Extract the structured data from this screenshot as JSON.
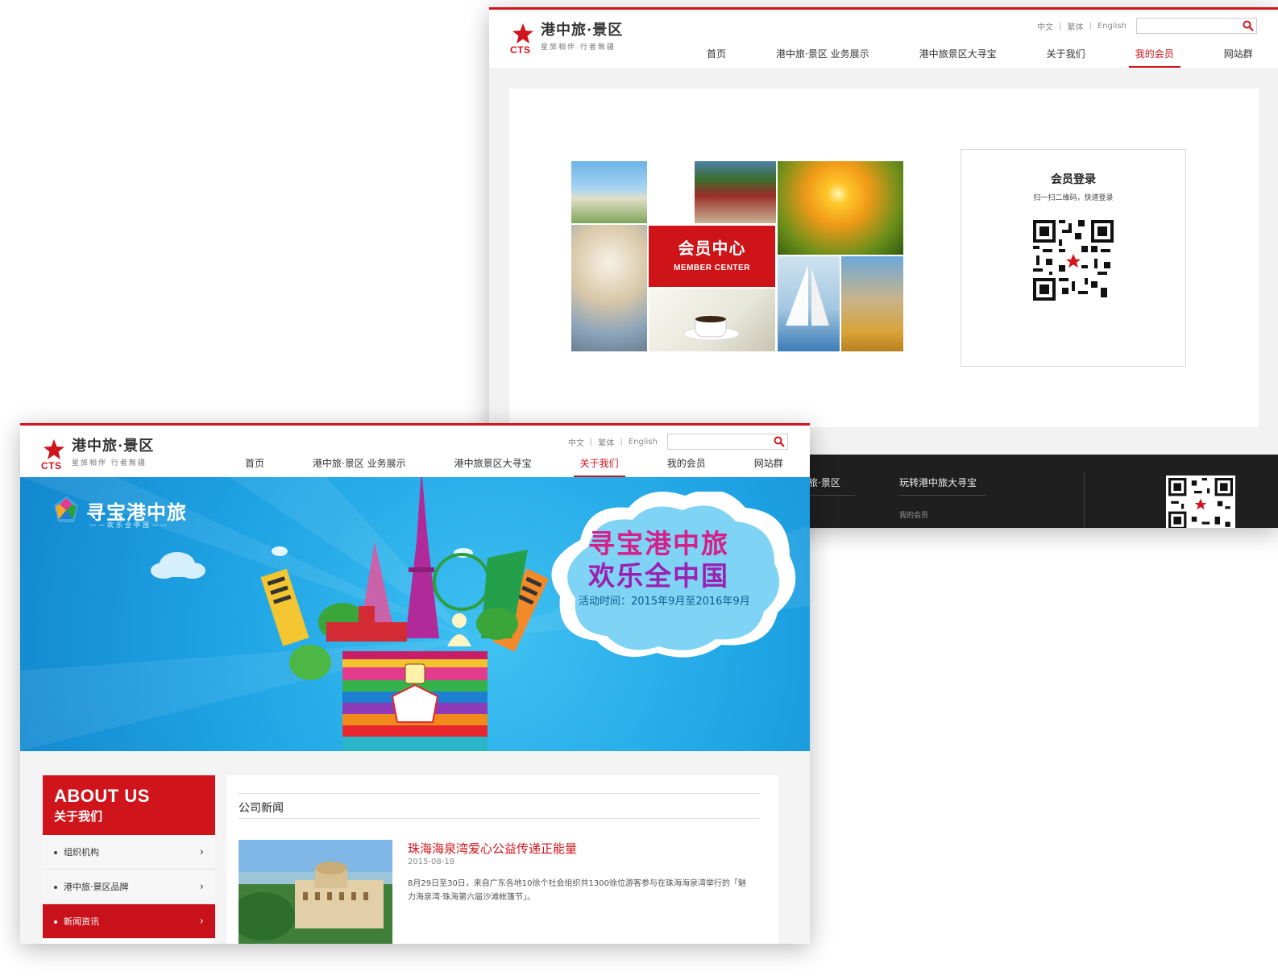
{
  "back_window": {
    "logo": {
      "brand": "港中旅·景区",
      "slogan": "星旅相伴 行者無疆",
      "cts": "CTS"
    },
    "lang": {
      "zh": "中文",
      "tw": "繁体",
      "en": "English"
    },
    "search": {
      "placeholder": ""
    },
    "nav": [
      {
        "label": "首页"
      },
      {
        "label": "港中旅·景区 业务展示"
      },
      {
        "label": "港中旅景区大寻宝"
      },
      {
        "label": "关于我们"
      },
      {
        "label": "我的会员"
      },
      {
        "label": "网站群"
      }
    ],
    "active_nav": "我的会员",
    "member_center": {
      "title": "会员中心",
      "subtitle": "MEMBER CENTER"
    },
    "login": {
      "title": "会员登录",
      "hint": "扫一扫二维码，快速登录"
    },
    "footer": {
      "col1": "中旅·景区",
      "col2": "玩转港中旅大寻宝",
      "link": "我的会员"
    }
  },
  "front_window": {
    "logo": {
      "brand": "港中旅·景区",
      "slogan": "星旅相伴 行者無疆",
      "cts": "CTS"
    },
    "lang": {
      "zh": "中文",
      "tw": "繁体",
      "en": "English"
    },
    "search": {
      "placeholder": ""
    },
    "nav": [
      {
        "label": "首页"
      },
      {
        "label": "港中旅·景区 业务展示"
      },
      {
        "label": "港中旅景区大寻宝"
      },
      {
        "label": "关于我们"
      },
      {
        "label": "我的会员"
      },
      {
        "label": "网站群"
      }
    ],
    "active_nav": "关于我们",
    "banner": {
      "logo_title": "寻宝港中旅",
      "logo_sub": "——欢乐全中国——",
      "headline1": "寻宝港中旅",
      "headline2": "欢乐全中国",
      "period": "活动时间：2015年9月至2016年9月"
    },
    "sidebar": {
      "title_en": "ABOUT US",
      "title_zh": "关于我们",
      "items": [
        {
          "label": "组织机构"
        },
        {
          "label": "港中旅·景区品牌"
        },
        {
          "label": "新闻资讯"
        }
      ],
      "active_item": "新闻资讯"
    },
    "section_title": "公司新闻",
    "news": {
      "title": "珠海海泉湾爱心公益传递正能量",
      "date": "2015-08-18",
      "summary": "8月29日至30日，来自广东各地10徐个社会组织共1300徐位游客参与在珠海海泉湾举行的「魅力海泉湾·珠海第六届沙滩帐篷节」。"
    }
  },
  "colors": {
    "brand_red": "#d0141b",
    "footer_bg": "#1f1f1f",
    "banner_blue": "#1ea3e4"
  }
}
